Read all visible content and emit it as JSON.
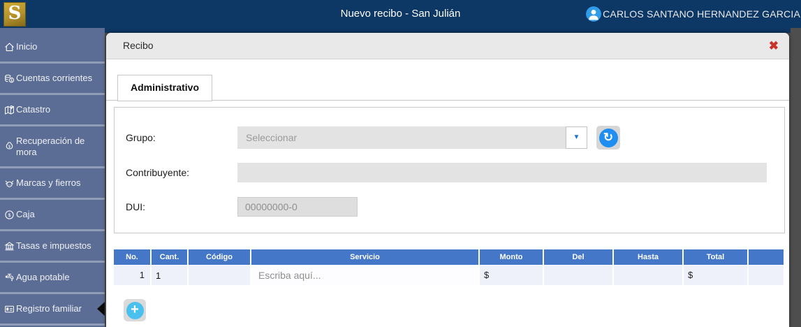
{
  "app": {
    "logo_letter": "S",
    "title": "Nuevo recibo - San Julián",
    "user_name": "CARLOS SANTANO HERNANDEZ GARCIA"
  },
  "icons": {
    "close": "✖",
    "dropdown_arrow": "▼",
    "refresh": "↻",
    "add": "+"
  },
  "sidebar": {
    "items": [
      {
        "label": "Inicio"
      },
      {
        "label": "Cuentas corrientes"
      },
      {
        "label": "Catastro"
      },
      {
        "label": "Recuperación de mora"
      },
      {
        "label": "Marcas y fierros"
      },
      {
        "label": "Caja"
      },
      {
        "label": "Tasas e impuestos"
      },
      {
        "label": "Agua potable"
      },
      {
        "label": "Registro familiar",
        "active": true
      }
    ]
  },
  "modal": {
    "title": "Recibo",
    "tabs": [
      {
        "label": "Administrativo",
        "active": true
      }
    ],
    "form": {
      "grupo_label": "Grupo:",
      "grupo_value": "Seleccionar",
      "contribuyente_label": "Contribuyente:",
      "contribuyente_value": "",
      "dui_label": "DUI:",
      "dui_placeholder": "00000000-0"
    },
    "table": {
      "columns": [
        "No.",
        "Cant.",
        "Código",
        "Servicio",
        "Monto",
        "Del",
        "Hasta",
        "Total",
        ""
      ],
      "rows": [
        {
          "no": "1",
          "cant": "1",
          "codigo": "",
          "servicio_placeholder": "Escriba aquí...",
          "monto_currency": "$",
          "del": "",
          "hasta": "",
          "total_currency": "$"
        }
      ]
    }
  },
  "colors": {
    "header_navy": "#0d3764",
    "sidebar_blue": "#5c6d95",
    "table_header_blue": "#4577c8",
    "table_row_lavender": "#eef0fa",
    "accent_blue": "#1f8ef1",
    "close_red": "#c7342c",
    "logo_gold": "#b3912b",
    "add_blue": "#4ac0ef"
  }
}
